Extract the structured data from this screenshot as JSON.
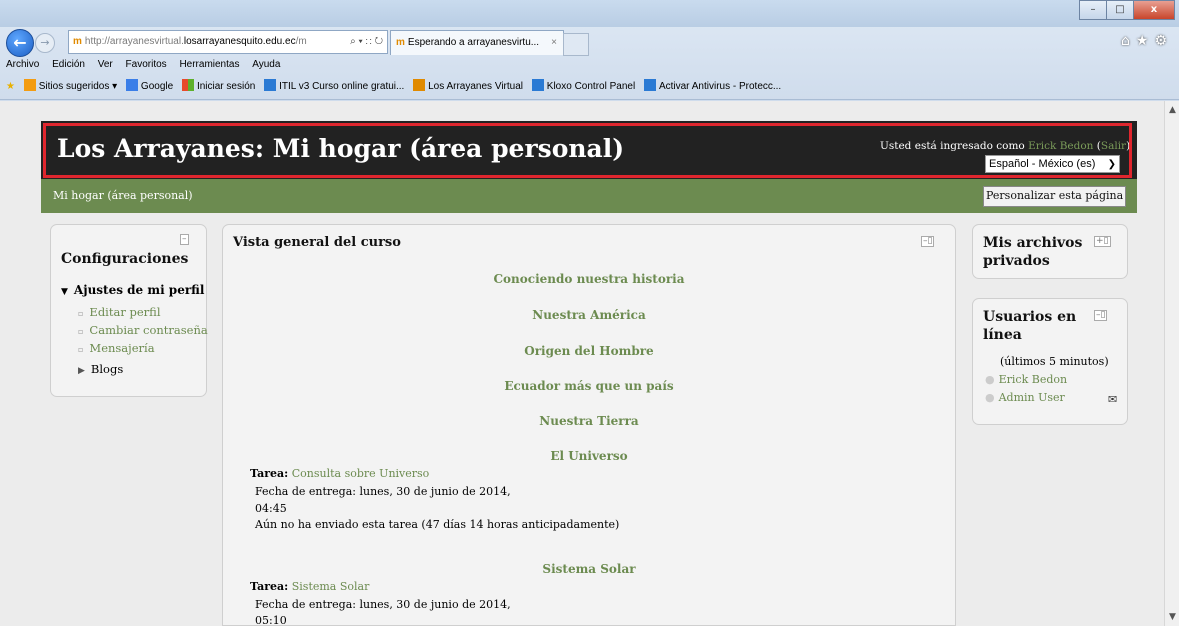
{
  "browser": {
    "address_url_prefix": "http://arrayanesvirtual.",
    "address_url_domain": "losarrayanesquito.edu.ec",
    "address_url_suffix": "/m",
    "address_tools": "⌕ ▾ ∷ ↻",
    "tab_title": "Esperando a arrayanesvirtu...",
    "tab_close": "×",
    "right_icons": "⌂★⚙",
    "window_buttons": {
      "minimize": "–",
      "maximize": "□",
      "close": "x"
    },
    "menu": [
      "Archivo",
      "Edición",
      "Ver",
      "Favoritos",
      "Herramientas",
      "Ayuda"
    ],
    "favorites": [
      {
        "label": "Sitios sugeridos ▾",
        "icon": "suggested-sites-icon",
        "color": "#f39c12"
      },
      {
        "label": "Google",
        "icon": "google-icon",
        "color": "#3a7ee8"
      },
      {
        "label": "Iniciar sesión",
        "icon": "windows-icon",
        "color": "#e84a2b"
      },
      {
        "label": "ITIL v3 Curso online gratui...",
        "icon": "ie-page-icon",
        "color": "#2a7ad4"
      },
      {
        "label": "Los Arrayanes Virtual",
        "icon": "moodle-icon",
        "color": "#e08a00"
      },
      {
        "label": "Kloxo Control Panel",
        "icon": "ie-page-icon",
        "color": "#2a7ad4"
      },
      {
        "label": "Activar Antivirus - Protecc...",
        "icon": "ie-page-icon",
        "color": "#2a7ad4"
      }
    ]
  },
  "header": {
    "title": "Los Arrayanes: Mi hogar (área personal)",
    "login_prefix": "Usted está ingresado como",
    "user": "Erick Bedon",
    "logout": "(Salir)",
    "language": "Español - México (es)"
  },
  "navbar": {
    "breadcrumb": "Mi hogar (área personal)",
    "customize": "Personalizar esta página"
  },
  "settings": {
    "title": "Configuraciones",
    "section": "Ajustes de mi perfil",
    "items": [
      "Editar perfil",
      "Cambiar contraseña",
      "Mensajería"
    ],
    "blogs": "Blogs"
  },
  "overview": {
    "title": "Vista general del curso",
    "courses": [
      "Conociendo nuestra historia",
      "Nuestra América",
      "Origen del Hombre",
      "Ecuador más que un país",
      "Nuestra Tierra",
      "El Universo"
    ],
    "task1": {
      "label": "Tarea:",
      "link": "Consulta sobre Universo",
      "due": "Fecha de entrega: lunes, 30 de junio de 2014,",
      "time": "04:45",
      "status": "Aún no ha enviado esta tarea (47 días 14 horas anticipadamente)"
    },
    "course7": "Sistema Solar",
    "task2": {
      "label": "Tarea:",
      "link": "Sistema Solar",
      "due": "Fecha de entrega: lunes, 30 de junio de 2014,",
      "time": "05:10"
    }
  },
  "private_files": {
    "title_line1": "Mis archivos",
    "title_line2": "privados"
  },
  "online_users": {
    "title_line1": "Usuarios en",
    "title_line2": "línea",
    "period": "(últimos 5 minutos)",
    "users": [
      "Erick Bedon",
      "Admin User"
    ]
  },
  "colors": {
    "accent_green": "#6c8b50",
    "header_bg": "#222222",
    "highlight_red": "#e0262e"
  }
}
